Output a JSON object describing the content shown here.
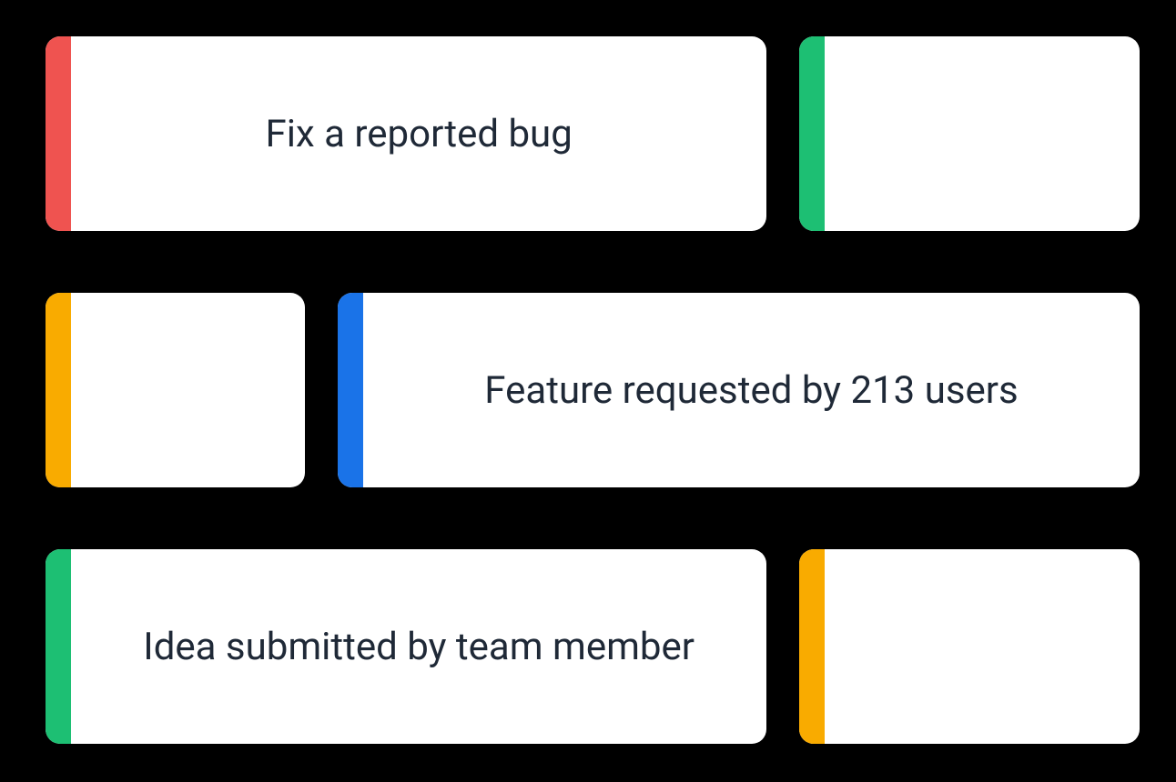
{
  "cards": [
    {
      "label": "Fix a reported bug",
      "accent": "accent-red"
    },
    {
      "label": "",
      "accent": "accent-green"
    },
    {
      "label": "",
      "accent": "accent-yellow"
    },
    {
      "label": "Feature requested by 213 users",
      "accent": "accent-blue"
    },
    {
      "label": "Idea submitted by team member",
      "accent": "accent-green"
    },
    {
      "label": "",
      "accent": "accent-yellow"
    }
  ]
}
